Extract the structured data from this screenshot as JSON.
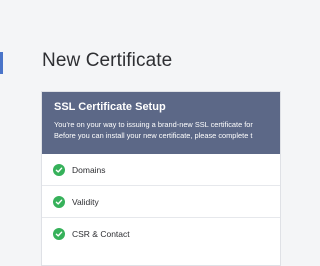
{
  "page": {
    "title": "New Certificate"
  },
  "setup": {
    "title": "SSL Certificate Setup",
    "intro_line1": "You're on your way to issuing a brand-new SSL certificate for",
    "intro_line2": "Before you can install your new certificate, please complete t"
  },
  "steps": [
    {
      "label": "Domains",
      "status": "complete",
      "icon": "check-circle-icon"
    },
    {
      "label": "Validity",
      "status": "complete",
      "icon": "check-circle-icon"
    },
    {
      "label": "CSR & Contact",
      "status": "complete",
      "icon": "check-circle-icon"
    }
  ],
  "colors": {
    "accent": "#4a74c9",
    "header_bg": "#5c6887",
    "success": "#36b15a"
  }
}
